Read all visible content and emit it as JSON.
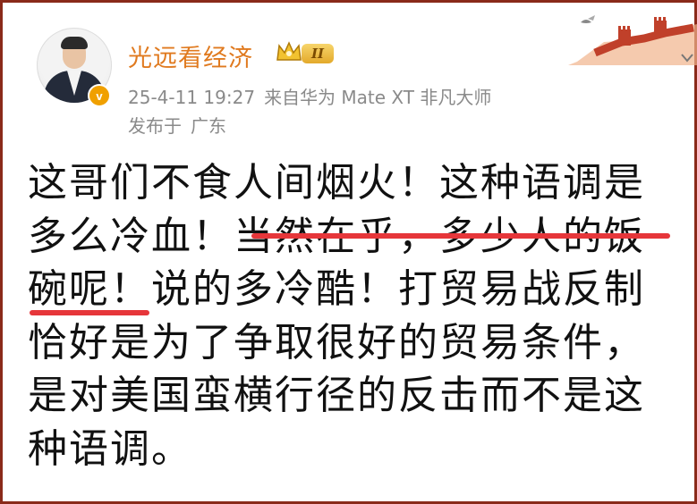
{
  "author": {
    "name": "光远看经济",
    "level_badge": "II"
  },
  "meta": {
    "timestamp": "25-4-11 19:27",
    "source_prefix": "来自",
    "device": "华为 Mate XT 非凡大师"
  },
  "location": {
    "prefix": "发布于",
    "region": "广东"
  },
  "post": {
    "lines": [
      "这哥们不食人间烟火！这种语调是",
      "多么冷血！当然在乎，多少人的饭",
      "碗呢！说的多冷酷！打贸易战反制",
      "恰好是为了争取很好的贸易条件，",
      "是对美国蛮横行径的反击而不是这",
      "种语调。"
    ]
  },
  "colors": {
    "username": "#e07a1f",
    "underline": "#e6363a",
    "meta": "#8a8a8a",
    "frame": "#8a2a1a"
  },
  "icons": {
    "verified": "verified-v-icon",
    "crown": "crown-icon",
    "decoration": "great-wall-sticker",
    "more": "chevron-down-icon"
  }
}
